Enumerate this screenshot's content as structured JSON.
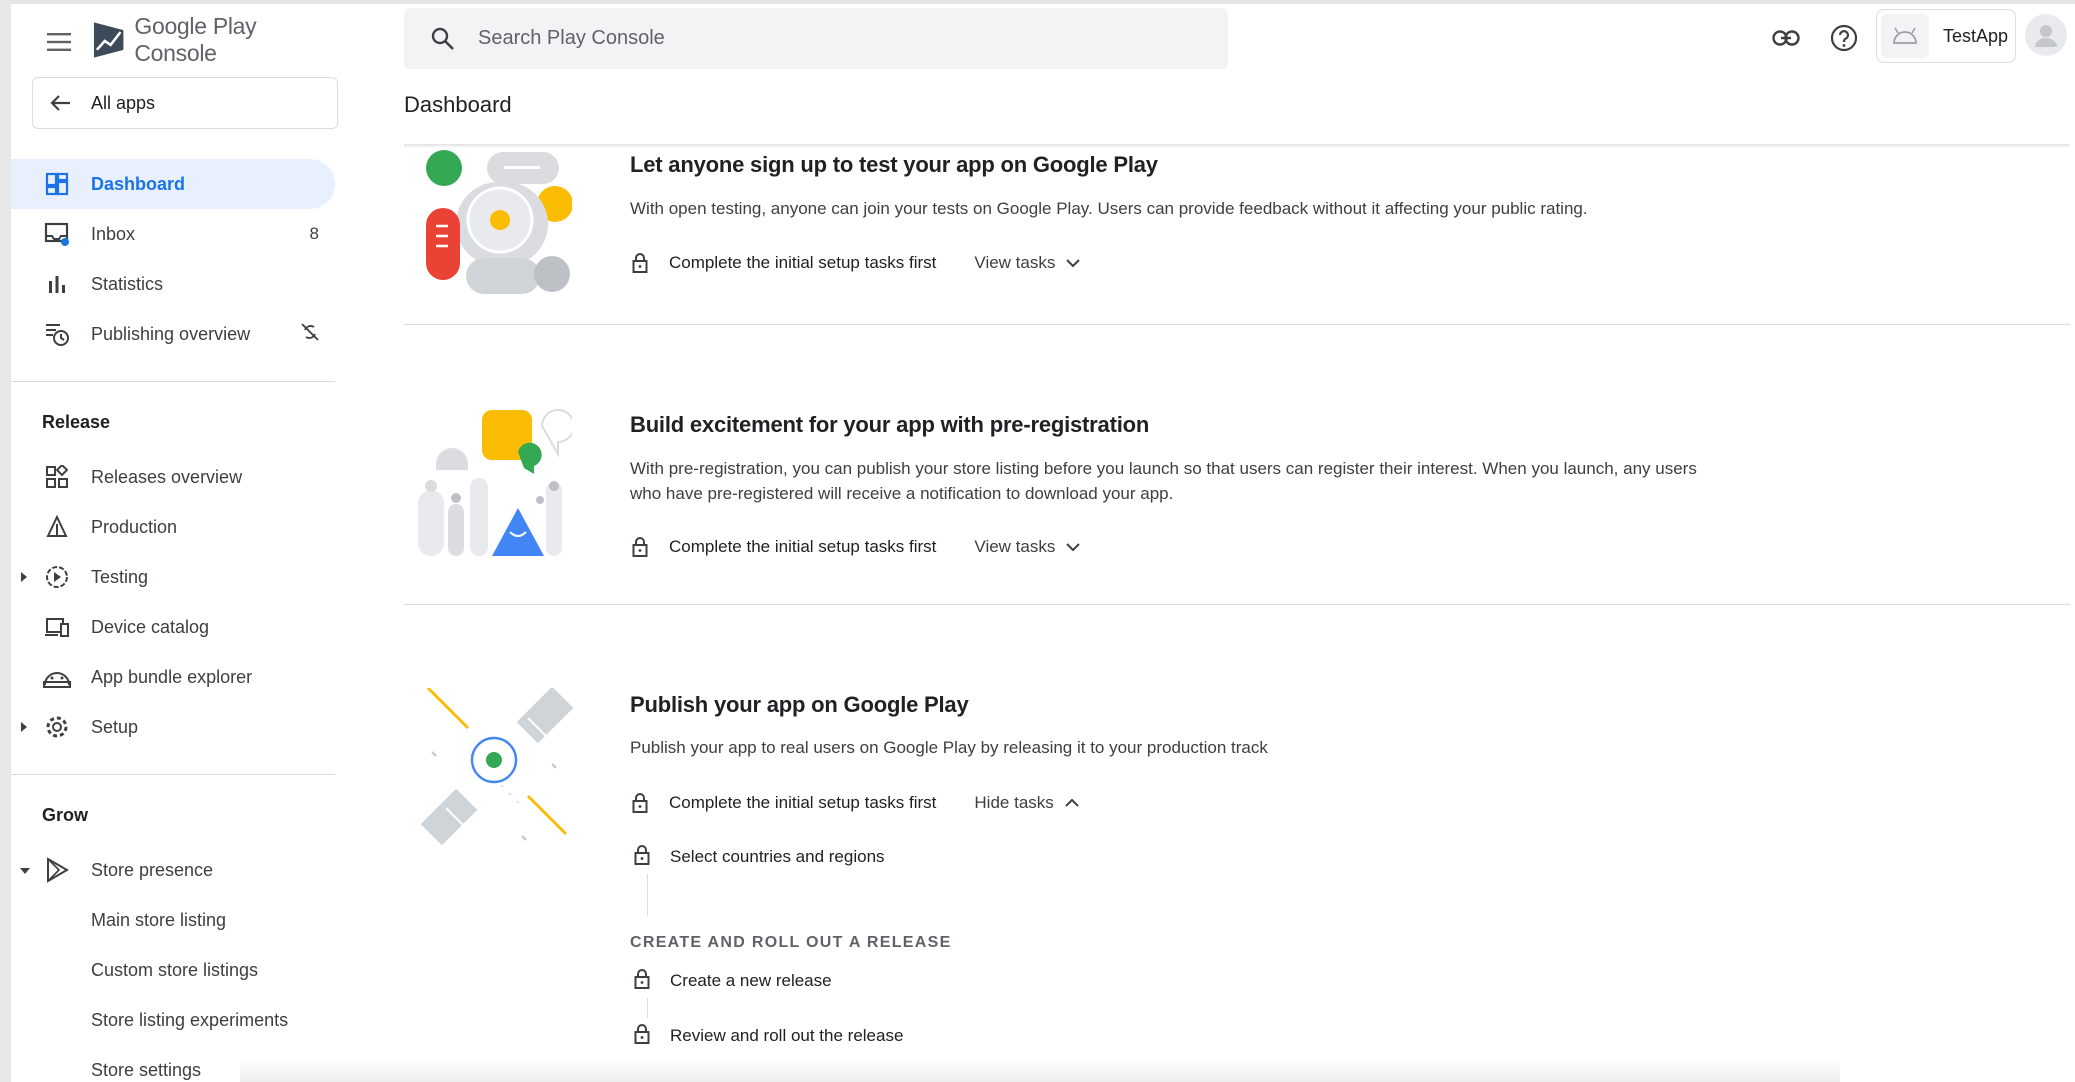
{
  "app": {
    "brand_google": "Google Play",
    "brand_console": "Console"
  },
  "sidebar": {
    "all_apps": "All apps",
    "primary": [
      {
        "label": "Dashboard",
        "active": true,
        "icon": "dashboard-icon"
      },
      {
        "label": "Inbox",
        "count": "8",
        "icon": "inbox-icon"
      },
      {
        "label": "Statistics",
        "icon": "bar-chart-icon"
      },
      {
        "label": "Publishing overview",
        "icon": "publishing-icon"
      }
    ],
    "release_heading": "Release",
    "release": [
      {
        "label": "Releases overview",
        "icon": "grid-icon"
      },
      {
        "label": "Production",
        "icon": "production-icon"
      },
      {
        "label": "Testing",
        "icon": "testing-icon"
      },
      {
        "label": "Device catalog",
        "icon": "devices-icon"
      },
      {
        "label": "App bundle explorer",
        "icon": "bundle-icon"
      },
      {
        "label": "Setup",
        "icon": "gear-icon"
      }
    ],
    "grow_heading": "Grow",
    "grow": [
      {
        "label": "Store presence",
        "icon": "play-icon"
      }
    ],
    "grow_sub": [
      "Main store listing",
      "Custom store listings",
      "Store listing experiments",
      "Store settings"
    ]
  },
  "header": {
    "search_placeholder": "Search Play Console",
    "app_name": "TestApp"
  },
  "page": {
    "title": "Dashboard"
  },
  "cards": [
    {
      "title": "Let anyone sign up to test your app on Google Play",
      "description": "With open testing, anyone can join your tests on Google Play. Users can provide feedback without it affecting your public rating.",
      "status": "Complete the initial setup tasks first",
      "toggle": "View tasks"
    },
    {
      "title": "Build excitement for your app with pre-registration",
      "description": "With pre-registration, you can publish your store listing before you launch so that users can register their interest. When you launch, any users who have pre-registered will receive a notification to download your app.",
      "status": "Complete the initial setup tasks first",
      "toggle": "View tasks"
    },
    {
      "title": "Publish your app on Google Play",
      "description": "Publish your app to real users on Google Play by releasing it to your production track",
      "status": "Complete the initial setup tasks first",
      "toggle": "Hide tasks",
      "task_first": "Select countries and regions",
      "group_heading": "CREATE AND ROLL OUT A RELEASE",
      "tasks": [
        "Create a new release",
        "Review and roll out the release"
      ]
    }
  ],
  "colors": {
    "accent": "#1a73e8",
    "active_bg": "#e8f0fe",
    "text": "#202124",
    "muted": "#5f6368",
    "green": "#34a853",
    "yellow": "#fbbc04",
    "red": "#ea4335"
  }
}
